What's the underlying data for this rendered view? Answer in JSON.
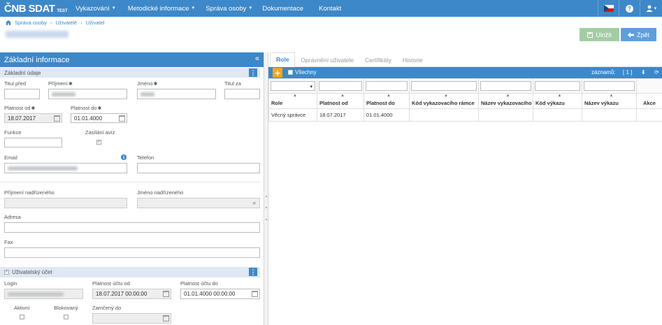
{
  "nav": {
    "brand": "ČNB SDAT",
    "env": "TEST",
    "menu": [
      {
        "label": "Vykazování",
        "dropdown": true
      },
      {
        "label": "Metodické informace",
        "dropdown": true
      },
      {
        "label": "Správa osoby",
        "dropdown": true
      },
      {
        "label": "Dokumentace",
        "dropdown": false
      },
      {
        "label": "Kontakt",
        "dropdown": false
      }
    ],
    "help_label": "?",
    "user_caret": "▾"
  },
  "breadcrumb": {
    "home_icon": "home-icon",
    "items": [
      "Správa osoby",
      "Uživatelé",
      "Uživatel"
    ],
    "separator": "›"
  },
  "toolbar": {
    "save_label": "Uložit",
    "back_label": "Zpět",
    "save_icon": "save-icon",
    "back_icon": "arrow-left-icon"
  },
  "left": {
    "header": "Základní informace",
    "collapse_icon": "«",
    "section1": "Základní údaje",
    "menu_icon": "⋮",
    "fields": {
      "titul_pred": {
        "label": "Titul před",
        "value": ""
      },
      "prijmeni": {
        "label": "Příjmení",
        "required": true
      },
      "jmeno": {
        "label": "Jméno",
        "required": true
      },
      "titul_za": {
        "label": "Titul za",
        "value": ""
      },
      "platnost_od": {
        "label": "Platnost od",
        "value": "18.07.2017"
      },
      "platnost_do": {
        "label": "Platnost do",
        "value": "01.01.4000"
      },
      "funkce": {
        "label": "Funkce",
        "value": ""
      },
      "zasilani": {
        "label": "Zasílání avíz",
        "checked": true
      },
      "email": {
        "label": "Email"
      },
      "telefon": {
        "label": "Telefon",
        "value": ""
      },
      "prijmeni_nadr": {
        "label": "Příjmení nadřízeného",
        "value": ""
      },
      "jmeno_nadr": {
        "label": "Jméno nadřízeného",
        "value": ""
      },
      "adresa": {
        "label": "Adresa",
        "value": ""
      },
      "fax": {
        "label": "Fax",
        "value": ""
      }
    },
    "section2": "Uživatelský účet",
    "account": {
      "login": {
        "label": "Login"
      },
      "platnost_uctu_od": {
        "label": "Platnost účtu od",
        "value": "18.07.2017 00:00:00"
      },
      "platnost_uctu_do": {
        "label": "Platnost účtu do",
        "value": "01.01.4000 00:00:00"
      },
      "aktivni": {
        "label": "Aktivní"
      },
      "blokovany": {
        "label": "Blokovaný"
      },
      "zamceny_do": {
        "label": "Zamčený do",
        "value": ""
      }
    },
    "star": "✱",
    "check_mark": "✓"
  },
  "right": {
    "tabs": [
      "Role",
      "Oprávnění uživatele",
      "Certifikáty",
      "Historie"
    ],
    "active_tab": 0,
    "add_label": "+",
    "all_label": "Všechny",
    "count_label": "záznamů:",
    "count_value": "[ 1 ]",
    "download_icon": "⬇",
    "refresh_icon": "⟳",
    "columns": [
      "Role",
      "Platnost od",
      "Platnost do",
      "Kód vykazovacího rámce",
      "Název vykazovacího",
      "Kód výkazu",
      "Název výkazu",
      "Akce"
    ],
    "rows": [
      [
        "Věcný správce",
        "18.07.2017",
        "01.01.4000",
        "",
        "",
        "",
        "",
        ""
      ]
    ],
    "sort_arrow": "▲",
    "select_arrow": "▾"
  },
  "colors": {
    "primary": "#3d88c8",
    "save": "#a4cca4",
    "back": "#5d9fdc",
    "add": "#f5a623"
  }
}
